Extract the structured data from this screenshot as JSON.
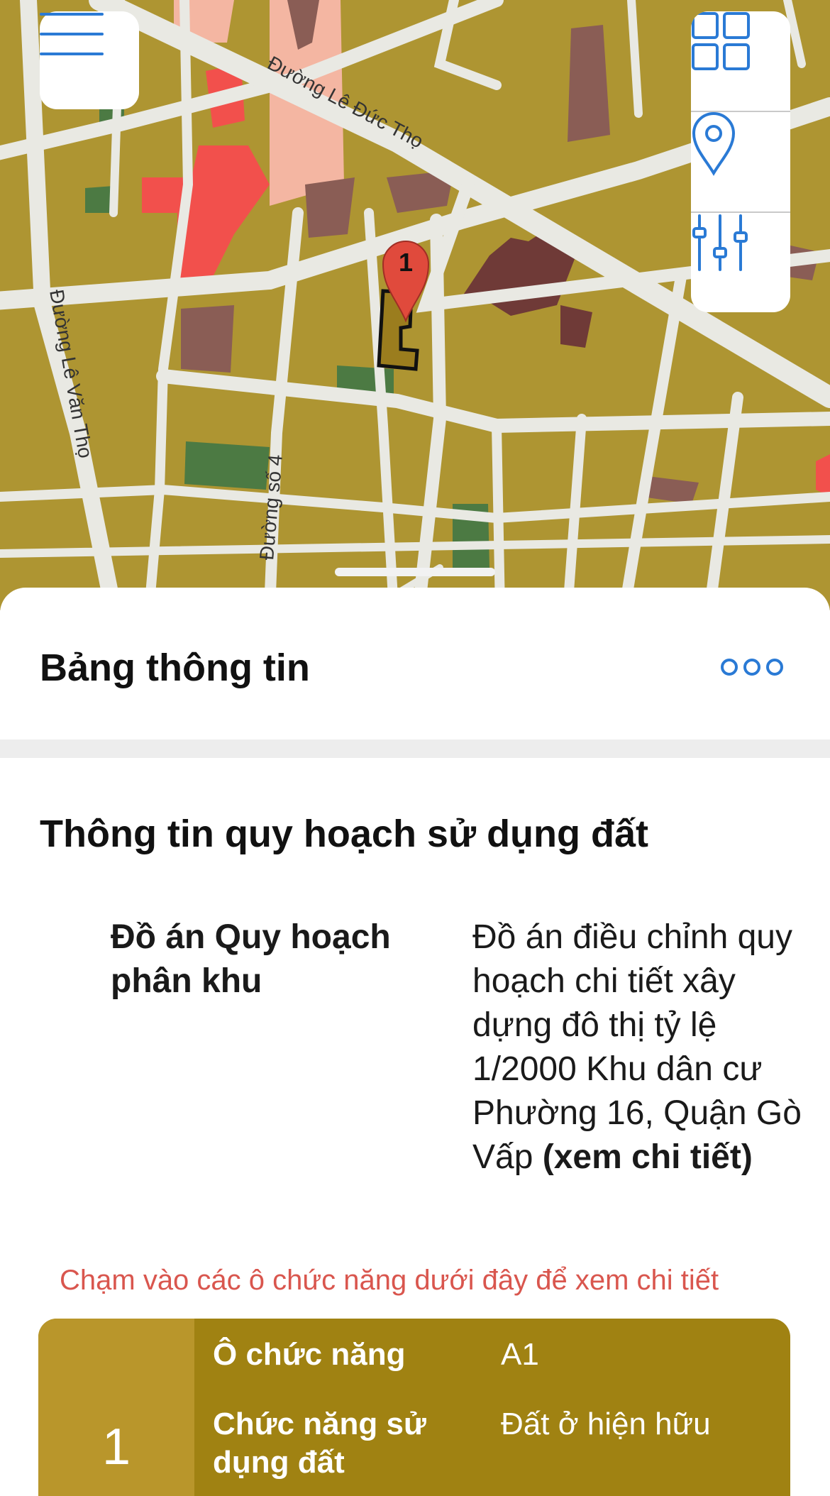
{
  "map": {
    "street_labels": [
      "Đường Lê Đức Thọ",
      "Đường Lê Văn Thọ",
      "Đường số 4"
    ],
    "marker": {
      "number": "1",
      "color": "#e04a3c"
    },
    "colors": {
      "residential": "#ae9532",
      "road": "#e9e9e3",
      "commercial": "#f2504c",
      "mixed": "#f4b6a2",
      "public": "#8a5d55",
      "green": "#4c7a43",
      "selected_parcel": "#9b7d1e"
    },
    "controls": {
      "menu_icon": "hamburger-menu-icon",
      "layers_icon": "grid-layers-icon",
      "location_icon": "location-pin-icon",
      "filter_icon": "sliders-icon",
      "accent_color": "#2a7ad5"
    }
  },
  "sheet": {
    "title": "Bảng thông tin",
    "more_icon": "more-options-icon",
    "section_title": "Thông tin quy hoạch sử dụng đất",
    "plan": {
      "label": "Đồ án Quy hoạch phân khu",
      "value": "Đồ án điều chỉnh quy hoạch chi tiết xây dựng đô thị tỷ lệ 1/2000 Khu dân cư Phường 16, Quận Gò Vấp",
      "link": "(xem chi tiết)"
    },
    "hint": "Chạm vào các ô chức năng dưới đây để xem chi tiết",
    "function_card": {
      "index": "1",
      "rows": [
        {
          "label": "Ô chức năng",
          "value": "A1"
        },
        {
          "label": "Chức năng sử dụng đất",
          "value": "Đất ở hiện hữu"
        }
      ],
      "color": "#a08212"
    }
  }
}
